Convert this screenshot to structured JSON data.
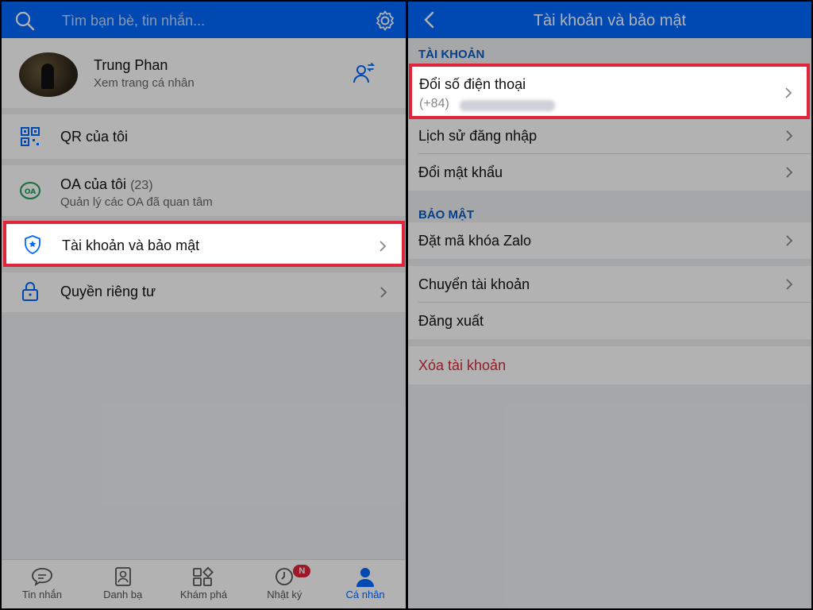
{
  "left": {
    "search_placeholder": "Tìm bạn bè, tin nhắn...",
    "profile": {
      "name": "Trung Phan",
      "subtitle": "Xem trang cá nhân"
    },
    "items": [
      {
        "label": "QR của tôi",
        "icon": "qr-icon"
      },
      {
        "label": "OA của tôi",
        "count": "(23)",
        "subtitle": "Quản lý các OA đã quan tâm",
        "icon": "oa-icon"
      },
      {
        "label": "Tài khoản và bảo mật",
        "icon": "shield-icon"
      },
      {
        "label": "Quyền riêng tư",
        "icon": "lock-icon"
      }
    ],
    "bottom_nav": [
      {
        "label": "Tin nhắn",
        "icon": "chat-icon"
      },
      {
        "label": "Danh bạ",
        "icon": "contacts-icon"
      },
      {
        "label": "Khám phá",
        "icon": "explore-icon"
      },
      {
        "label": "Nhật ký",
        "icon": "clock-icon",
        "badge": "N"
      },
      {
        "label": "Cá nhân",
        "icon": "person-icon",
        "active": true
      }
    ]
  },
  "right": {
    "title": "Tài khoản và bảo mật",
    "section_account": "TÀI KHOẢN",
    "change_phone": {
      "label": "Đổi số điện thoại",
      "prefix": "(+84)"
    },
    "login_history": "Lịch sử đăng nhập",
    "change_password": "Đổi mật khẩu",
    "section_security": "BẢO MẬT",
    "lock_code": "Đặt mã khóa Zalo",
    "switch_account": "Chuyển tài khoản",
    "logout": "Đăng xuất",
    "delete_account": "Xóa tài khoản"
  },
  "colors": {
    "brand": "#0068ff",
    "highlight": "#e0243a",
    "section_text": "#0a5cc8",
    "danger": "#d12c3a"
  }
}
